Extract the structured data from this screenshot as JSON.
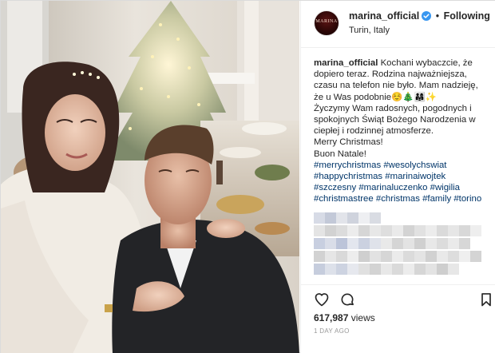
{
  "post": {
    "header": {
      "username": "marina_official",
      "follow_status": "Following",
      "separator": "•",
      "location": "Turin, Italy",
      "avatar_text": "MARINA",
      "verified_icon": "verified-badge-icon",
      "verified_color": "#3897f0"
    },
    "caption": {
      "username": "marina_official",
      "lines": [
        "Kochani wybaczcie, że",
        "dopiero teraz. Rodzina najważniejsza,",
        "czasu na telefon nie było. Mam nadzieję,",
        "że u Was podobnie☺️🎄👨‍👩‍👧✨",
        "Życzymy Wam radosnych, pogodnych i",
        "spokojnych Świąt Bożego Narodzenia w",
        "ciepłej i rodzinnej atmosferze.",
        "Merry Christmas!",
        "Buon Natale!"
      ],
      "hashtag_lines": [
        "#merrychristmas #wesolychswiat",
        "#happychristmas #marinaiwojtek",
        "#szczesny #marinaluczenko #wigilia",
        "#christmastree #christmas #family #torino"
      ],
      "hashtag_color": "#003569"
    },
    "actions": {
      "like_icon": "heart-icon",
      "comment_icon": "comment-icon",
      "save_icon": "bookmark-icon"
    },
    "views": {
      "count": "617,987",
      "label": "views"
    },
    "time_ago": "1 DAY AGO"
  },
  "colors": {
    "text": "#262626",
    "border": "#efefef",
    "muted": "#999999"
  }
}
